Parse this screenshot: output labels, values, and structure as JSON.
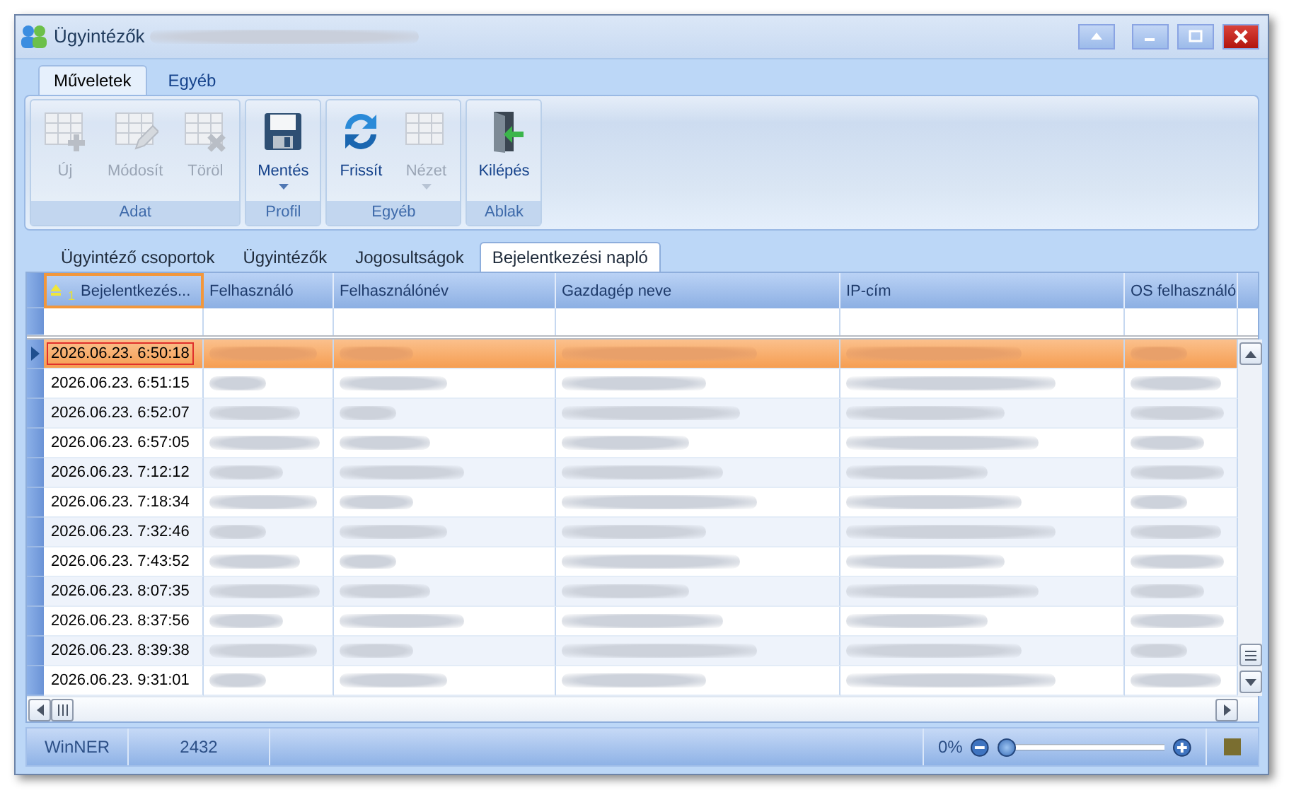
{
  "window": {
    "title": "Ügyintézők"
  },
  "ribbon_tabs": [
    {
      "label": "Műveletek",
      "selected": true
    },
    {
      "label": "Egyéb",
      "selected": false
    }
  ],
  "ribbon_groups": [
    {
      "label": "Adat",
      "buttons": [
        {
          "label": "Új",
          "kind": "grid-add",
          "disabled": true,
          "dropdown": false
        },
        {
          "label": "Módosít",
          "kind": "grid-edit",
          "disabled": true,
          "dropdown": false
        },
        {
          "label": "Töröl",
          "kind": "grid-delete",
          "disabled": true,
          "dropdown": false
        }
      ]
    },
    {
      "label": "Profil",
      "buttons": [
        {
          "label": "Mentés",
          "kind": "save",
          "disabled": false,
          "dropdown": true
        }
      ]
    },
    {
      "label": "Egyéb",
      "buttons": [
        {
          "label": "Frissít",
          "kind": "refresh",
          "disabled": false,
          "dropdown": false
        },
        {
          "label": "Nézet",
          "kind": "table",
          "disabled": true,
          "dropdown": true
        }
      ]
    },
    {
      "label": "Ablak",
      "buttons": [
        {
          "label": "Kilépés",
          "kind": "exit",
          "disabled": false,
          "dropdown": false
        }
      ]
    }
  ],
  "tabs": [
    {
      "label": "Ügyintéző csoportok",
      "selected": false
    },
    {
      "label": "Ügyintézők",
      "selected": false
    },
    {
      "label": "Jogosultságok",
      "selected": false
    },
    {
      "label": "Bejelentkezési napló",
      "selected": true
    }
  ],
  "table": {
    "columns": [
      {
        "label": "Bejelentkezés...",
        "sort_order": "1",
        "selected": true
      },
      {
        "label": "Felhasználó",
        "selected": false
      },
      {
        "label": "Felhasználónév",
        "selected": false
      },
      {
        "label": "Gazdagép neve",
        "selected": false
      },
      {
        "label": "IP-cím",
        "selected": false
      },
      {
        "label": "OS felhasználó",
        "selected": false
      }
    ],
    "rows": [
      {
        "time": "2026.06.23. 6:50:18",
        "selected": true
      },
      {
        "time": "2026.06.23. 6:51:15",
        "selected": false
      },
      {
        "time": "2026.06.23. 6:52:07",
        "selected": false
      },
      {
        "time": "2026.06.23. 6:57:05",
        "selected": false
      },
      {
        "time": "2026.06.23. 7:12:12",
        "selected": false
      },
      {
        "time": "2026.06.23. 7:18:34",
        "selected": false
      },
      {
        "time": "2026.06.23. 7:32:46",
        "selected": false
      },
      {
        "time": "2026.06.23. 7:43:52",
        "selected": false
      },
      {
        "time": "2026.06.23. 8:07:35",
        "selected": false
      },
      {
        "time": "2026.06.23. 8:37:56",
        "selected": false
      },
      {
        "time": "2026.06.23. 8:39:38",
        "selected": false
      },
      {
        "time": "2026.06.23. 9:31:01",
        "selected": false
      }
    ]
  },
  "status_bar": {
    "app": "WinNER",
    "count": "2432",
    "zoom_text": "0%",
    "zoom": {
      "level": 0
    }
  }
}
